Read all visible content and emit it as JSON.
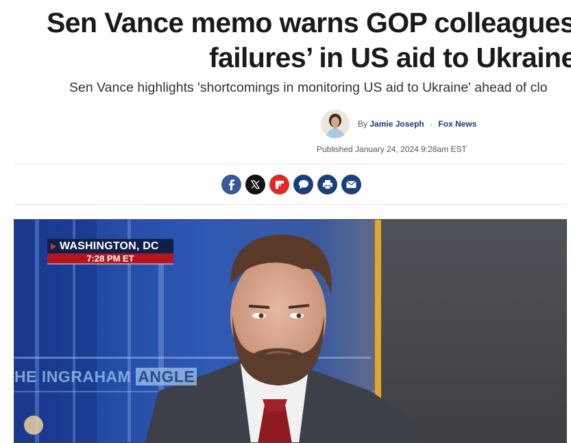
{
  "article": {
    "headline_line1": "Sen Vance memo warns GOP colleagues",
    "headline_line2": "failures’ in US aid to Ukraine",
    "subheadline": "Sen Vance highlights 'shortcomings in monitoring US aid to Ukraine' ahead of clo",
    "byline": {
      "prefix": "By",
      "author": "Jamie Joseph",
      "separator": "·",
      "outlet": "Fox News"
    },
    "published": "Published January 24, 2024 9:28am EST"
  },
  "share": [
    {
      "name": "facebook",
      "glyph": "f",
      "color": "#3b5998"
    },
    {
      "name": "x",
      "glyph": "𝕏",
      "color": "#111111"
    },
    {
      "name": "flipboard",
      "glyph": "",
      "color": "#e12828"
    },
    {
      "name": "comments",
      "glyph": "",
      "color": "#1a3f7a"
    },
    {
      "name": "print",
      "glyph": "",
      "color": "#1a3f7a"
    },
    {
      "name": "email",
      "glyph": "",
      "color": "#1a3f7a"
    }
  ],
  "hero": {
    "location": "WASHINGTON, DC",
    "time": "7:28 PM ET",
    "show_prefix": "HE INGRAHAM",
    "show_suffix": "ANGLE"
  }
}
